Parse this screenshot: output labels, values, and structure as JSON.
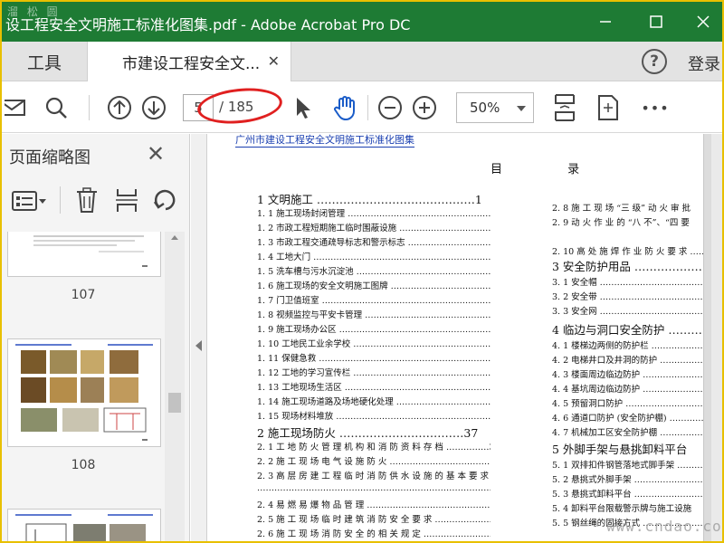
{
  "titlebar": {
    "title": "设工程安全文明施工标准化图集.pdf - Adobe Acrobat Pro DC",
    "watermark_top": "溜 松 圆",
    "colors": {
      "titlebar": "#1e7b34",
      "outer": "#e8c000",
      "annotation": "#e02020"
    }
  },
  "tabs": {
    "tools": "工具",
    "document": "市建设工程安全文...",
    "help": "?",
    "login": "登录"
  },
  "toolbar": {
    "current_page": "5",
    "total_pages": "/ 185",
    "zoom": "50%"
  },
  "icons": {
    "mail": "✉",
    "search": "⚲",
    "page_up": "↑",
    "page_down": "↓",
    "select": "➤",
    "hand": "✋",
    "zoom_out": "−",
    "zoom_in": "+",
    "more": "•••"
  },
  "panel": {
    "title": "页面缩略图",
    "thumbnails": [
      "107",
      "108"
    ]
  },
  "doc": {
    "header": "广州市建设工程安全文明施工标准化图集",
    "toc_title": "目 录",
    "left": [
      {
        "t": "h",
        "text": "1   文明施工 ……………………………………1"
      },
      {
        "t": "s",
        "text": "1. 1   施工现场封闭管理 ……………………………………………………………1"
      },
      {
        "t": "s",
        "text": "1. 2   市政工程短期施工临时围蔽设施 …………………………………………10"
      },
      {
        "t": "s",
        "text": "1. 3   市政工程交通疏导标志和警示标志 …………………………………………14"
      },
      {
        "t": "s",
        "text": "1. 4   工地大门 ……………………………………………………………………15"
      },
      {
        "t": "s",
        "text": "1. 5   洗车槽与污水沉淀池 ………………………………………………………18"
      },
      {
        "t": "s",
        "text": "1. 6   施工现场的安全文明施工图牌 ……………………………………………19"
      },
      {
        "t": "s",
        "text": "1. 7   门卫值班室 …………………………………………………………………20"
      },
      {
        "t": "s",
        "text": "1. 8   视频监控与平安卡管理 ……………………………………………………21"
      },
      {
        "t": "s",
        "text": "1. 9   施工现场办公区 ……………………………………………………………22"
      },
      {
        "t": "s",
        "text": "1. 10   工地民工业余学校 ………………………………………………………24"
      },
      {
        "t": "s",
        "text": "1. 11   保健急救 …………………………………………………………………25"
      },
      {
        "t": "s",
        "text": "1. 12   工地的学习宣传栏 ………………………………………………………26"
      },
      {
        "t": "s",
        "text": "1. 13   工地现场生活区 …………………………………………………………27"
      },
      {
        "t": "s",
        "text": "1. 14   施工现场道路及场地硬化处理 …………………………………………35"
      },
      {
        "t": "s",
        "text": "1. 15   现场材料堆放 ……………………………………………………………36"
      },
      {
        "t": "h",
        "text": "2   施工现场防火 ……………………………37"
      },
      {
        "t": "s",
        "text": "2. 1  工 地 防 火 管 理 机 构 和 消 防 资 料 存 档 ……………37"
      },
      {
        "t": "s",
        "text": "2. 2   施 工 现 场 电 气 设 施 防 火 ……………………………………38"
      },
      {
        "t": "s",
        "text": "2. 3   高 层 房 建 工 程 临 时 消 防 供 水 设 施 的 基 本 要 求"
      },
      {
        "t": "s",
        "text": "…………………………………………………………………………………39"
      },
      {
        "t": "s",
        "text": "2. 4   易 燃 易 爆 物 品 管 理 …………………………………………………42"
      },
      {
        "t": "s",
        "text": "2. 5   施 工 现 场 临 时 建 筑 消 防 安 全 要 求 ………………………43"
      },
      {
        "t": "s",
        "text": "2. 6   施 工 现 场 消 防 安 全 的 相 关 规 定 ……………………………43"
      }
    ],
    "right": [
      {
        "t": "s",
        "text": "2. 8  施 工 现 场 “三 级” 动 火 审 批"
      },
      {
        "t": "s",
        "text": "2. 9  动 火 作 业 的 “八 不”、“四 要"
      },
      {
        "t": "s",
        "text": ""
      },
      {
        "t": "s",
        "text": "2. 10  高 处 施 焊 作 业 防 火 要 求 ……"
      },
      {
        "t": "h",
        "text": "3   安全防护用品 ………………"
      },
      {
        "t": "s",
        "text": "3. 1   安全帽 ……………………………………"
      },
      {
        "t": "s",
        "text": "3. 2   安全带 ……………………………………"
      },
      {
        "t": "s",
        "text": "3. 3   安全网 ……………………………………"
      },
      {
        "t": "h",
        "text": "4   临边与洞口安全防护 ………"
      },
      {
        "t": "s",
        "text": "4. 1   楼梯边两侧的防护栏 ……………………"
      },
      {
        "t": "s",
        "text": "4. 2   电梯井口及井洞的防护 …………………"
      },
      {
        "t": "s",
        "text": "4. 3   楼面周边临边防护 ………………………"
      },
      {
        "t": "s",
        "text": "4. 4   基坑周边临边防护 ………………………"
      },
      {
        "t": "s",
        "text": "4. 5   预留洞口防护 ……………………………"
      },
      {
        "t": "s",
        "text": "4. 6   通道口防护 (安全防护棚) ……………"
      },
      {
        "t": "s",
        "text": "4. 7   机械加工区安全防护棚 …………………"
      },
      {
        "t": "h",
        "text": "5   外脚手架与悬挑卸料平台"
      },
      {
        "t": "s",
        "text": "5. 1   双排扣件钢管落地式脚手架 ……………"
      },
      {
        "t": "s",
        "text": "5. 2   悬挑式外脚手架 …………………………"
      },
      {
        "t": "s",
        "text": "5. 3   悬挑式卸料平台 …………………………"
      },
      {
        "t": "s",
        "text": "5. 4   卸料平台限载警示牌与施工设施"
      },
      {
        "t": "s",
        "text": "5. 5   钢丝绳的固接方式 ………………………"
      }
    ],
    "watermark": "www.cndao.com"
  }
}
